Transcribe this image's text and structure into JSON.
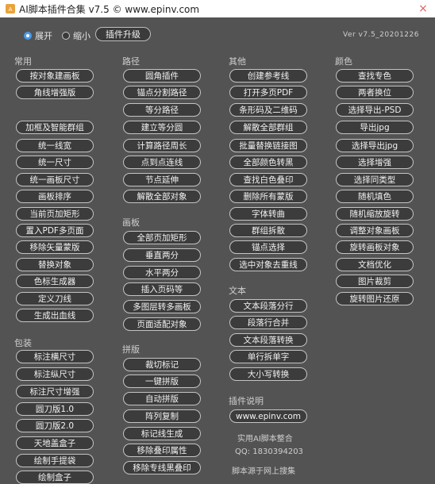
{
  "window": {
    "title": "AI脚本插件合集 v7.5 © www.epinv.com",
    "close_label": "×"
  },
  "topbar": {
    "expand_label": "展开",
    "collapse_label": "缩小",
    "upgrade_label": "插件升级",
    "version": "Ver v7.5_20201226"
  },
  "sections": {
    "common": "常用",
    "path": "路径",
    "other": "其他",
    "color": "颜色",
    "artboard": "画板",
    "text": "文本",
    "packaging": "包装",
    "imposition": "拼版",
    "plugin_info": "插件说明"
  },
  "col1": [
    "按对象建画板",
    "角线增强版",
    "加框及智能群组",
    "统一线宽",
    "统一尺寸",
    "统一画板尺寸",
    "画板排序",
    "当前页加矩形",
    "置入PDF多页面",
    "移除矢量蒙版",
    "替换对象",
    "色标生成器",
    "定义刀线",
    "生成出血线"
  ],
  "col1_pack": [
    "标注横尺寸",
    "标注纵尺寸",
    "标注尺寸增强",
    "圆刀版1.0",
    "圆刀版2.0",
    "天地盖盒子",
    "绘制手提袋",
    "绘制盒子"
  ],
  "col2_path": [
    "圆角插件",
    "锚点分割路径",
    "等分路径",
    "建立等分圆",
    "计算路径周长",
    "点到点连线",
    "节点延伸",
    "解散全部对象"
  ],
  "col2_artboard": [
    "全部页加矩形",
    "垂直两分",
    "水平两分",
    "插入页码等",
    "多图层转多画板",
    "页面适配对象"
  ],
  "col2_imposition": [
    "裁切标记",
    "一键拼版",
    "自动拼版",
    "阵列复制",
    "标记线生成",
    "移除叠印属性",
    "移除专线黑叠印"
  ],
  "col3_other": [
    "创建参考线",
    "打开多页PDF",
    "条形码及二维码",
    "解散全部群组",
    "批量替换链接图",
    "全部颜色转黑",
    "查找白色叠印",
    "删除所有蒙版",
    "字体转曲",
    "群组拆散",
    "锚点选择",
    "选中对象去重线"
  ],
  "col3_text": [
    "文本段落分行",
    "段落行合并",
    "文本段落转换",
    "单行拆单字",
    "大小写转换"
  ],
  "col3_info": {
    "website": "www.epinv.com",
    "line1": "实用AI脚本整合",
    "line2": "QQ: 1830394203",
    "line3": "脚本源于网上搜集"
  },
  "col4_color": [
    "查找专色",
    "两者换位",
    "选择导出-PSD",
    "导出jpg",
    "选择导出jpg",
    "选择增强",
    "选择同类型",
    "随机填色",
    "随机缩放旋转",
    "调整对象画板",
    "旋转画板对象",
    "文档优化",
    "图片裁剪",
    "旋转图片还原"
  ],
  "colors": {
    "background": "#535353",
    "button_bg": "#3c3c3c",
    "button_border": "#c4c4c4",
    "radio_on": "#4a9bea"
  }
}
